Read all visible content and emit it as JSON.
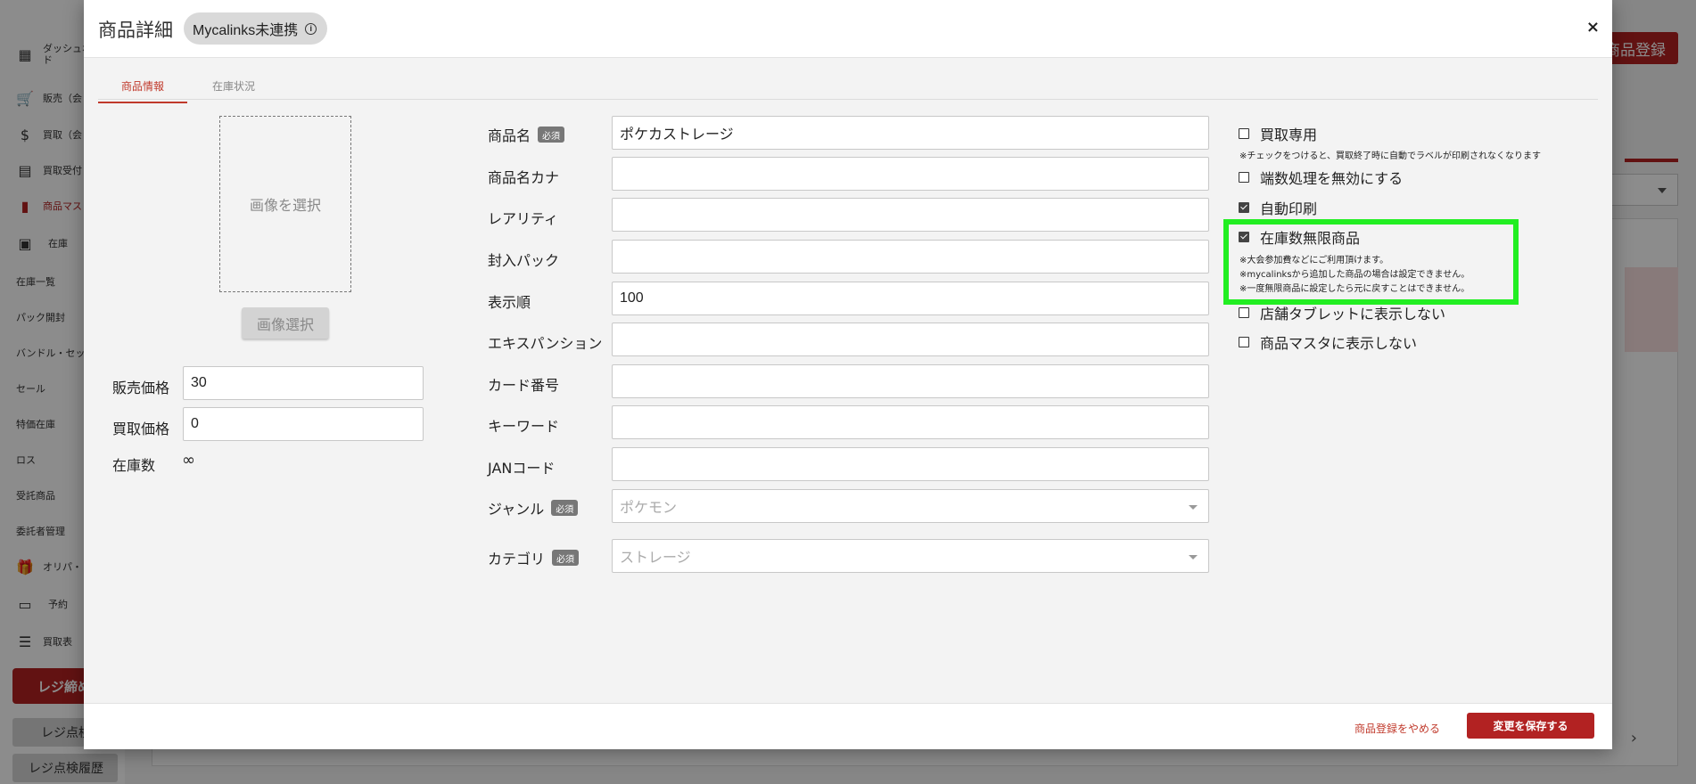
{
  "background": {
    "sidebar": [
      {
        "label": "ダッシュボー\nド",
        "icon": "dashboard-icon"
      },
      {
        "label": "販売（会",
        "icon": "cart-icon"
      },
      {
        "label": "買取（会",
        "icon": "dollar-icon"
      },
      {
        "label": "買取受付",
        "icon": "receipt-icon"
      },
      {
        "label": "商品マス",
        "icon": "bar-chart-icon"
      },
      {
        "label": "在庫",
        "icon": "archive-icon"
      },
      {
        "label": "在庫一覧"
      },
      {
        "label": "パック開封"
      },
      {
        "label": "バンドル・セッ"
      },
      {
        "label": "セール"
      },
      {
        "label": "特価在庫"
      },
      {
        "label": "ロス"
      },
      {
        "label": "受託商品"
      },
      {
        "label": "委託者管理"
      },
      {
        "label": "オリパ・",
        "icon": "gift-icon"
      },
      {
        "label": "予約",
        "icon": "register-icon"
      },
      {
        "label": "買取表",
        "icon": "list-icon"
      }
    ],
    "register_close_button": "レジ締め",
    "register_check_button": "レジ点検",
    "register_history_button": "レジ点検履歴",
    "product_register_button": "商品登録"
  },
  "modal": {
    "title": "商品詳細",
    "badge": "Mycalinks未連携",
    "tabs": [
      {
        "label": "商品情報",
        "active": true
      },
      {
        "label": "在庫状況",
        "active": false
      }
    ],
    "image": {
      "placeholder": "画像を選択",
      "button": "画像選択"
    },
    "price": {
      "sell_label": "販売価格",
      "sell_value": "30",
      "buy_label": "買取価格",
      "buy_value": "0",
      "stock_label": "在庫数",
      "stock_value": "∞"
    },
    "required_badge": "必須",
    "fields": [
      {
        "label": "商品名",
        "value": "ポケカストレージ",
        "required": true
      },
      {
        "label": "商品名カナ",
        "value": ""
      },
      {
        "label": "レアリティ",
        "value": ""
      },
      {
        "label": "封入パック",
        "value": ""
      },
      {
        "label": "表示順",
        "value": "100"
      },
      {
        "label": "エキスパンション",
        "value": ""
      },
      {
        "label": "カード番号",
        "value": ""
      },
      {
        "label": "キーワード",
        "value": ""
      },
      {
        "label": "JANコード",
        "value": ""
      }
    ],
    "genre": {
      "label": "ジャンル",
      "value": "ポケモン",
      "required": true
    },
    "category": {
      "label": "カテゴリ",
      "value": "ストレージ",
      "required": true
    },
    "options": [
      {
        "label": "買取専用",
        "checked": false
      },
      {
        "label": "端数処理を無効にする",
        "checked": false
      },
      {
        "label": "自動印刷",
        "checked": true
      },
      {
        "label": "在庫数無限商品",
        "checked": true
      },
      {
        "label": "店舗タブレットに表示しない",
        "checked": false
      },
      {
        "label": "商品マスタに表示しない",
        "checked": false
      }
    ],
    "notes": {
      "buy_only": "※チェックをつけると、買取終了時に自動でラベルが印刷されなくなります",
      "infinite_1": "※大会参加費などにご利用頂けます。",
      "infinite_2": "※mycalinksから追加した商品の場合は設定できません。",
      "infinite_3": "※一度無限商品に設定したら元に戻すことはできません。"
    },
    "footer": {
      "cancel": "商品登録をやめる",
      "save": "変更を保存する"
    },
    "highlight_color": "#22ee22",
    "accent_color": "#b22222"
  }
}
